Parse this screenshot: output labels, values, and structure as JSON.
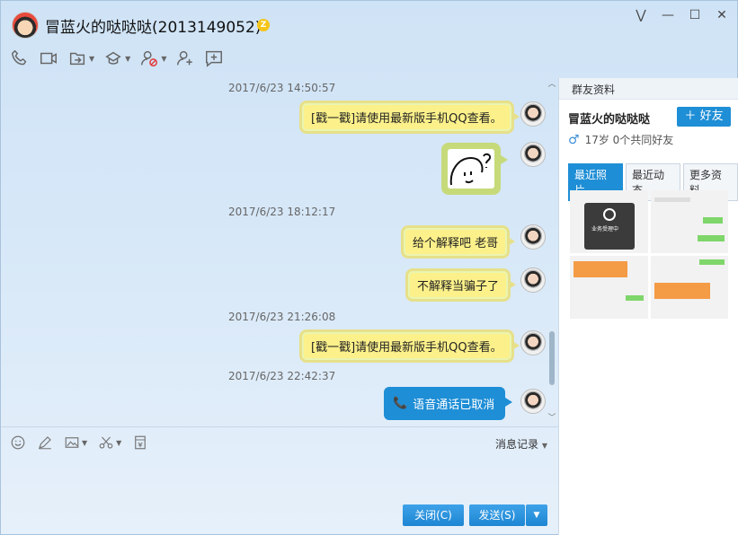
{
  "window": {
    "title": "冒蓝火的哒哒哒(2013149052)",
    "controls": [
      "⋁",
      "—",
      "☐",
      "✕"
    ]
  },
  "toolbar_icons": [
    "phone-icon",
    "video-icon",
    "share-screen-icon",
    "remote-help-icon",
    "block-user-icon",
    "add-contact-icon",
    "new-chat-icon"
  ],
  "messages": [
    {
      "type": "timestamp",
      "text": "2017/6/23 14:50:57"
    },
    {
      "type": "text",
      "text": "[戳一戳]请使用最新版手机QQ查看。"
    },
    {
      "type": "image",
      "alt": "sticker"
    },
    {
      "type": "timestamp",
      "text": "2017/6/23 18:12:17"
    },
    {
      "type": "text",
      "text": "给个解释吧 老哥"
    },
    {
      "type": "text",
      "text": "不解释当骗子了"
    },
    {
      "type": "timestamp",
      "text": "2017/6/23 21:26:08"
    },
    {
      "type": "text",
      "text": "[戳一戳]请使用最新版手机QQ查看。"
    },
    {
      "type": "timestamp",
      "text": "2017/6/23 22:42:37"
    },
    {
      "type": "call",
      "text": "语音通话已取消"
    }
  ],
  "input": {
    "history_label": "消息记录",
    "close_label": "关闭(C)",
    "send_label": "发送(S)"
  },
  "panel": {
    "header": "群友资料",
    "name": "冒蓝火的哒哒哒",
    "add_friend": "好友",
    "meta": "17岁 0个共同好友",
    "tabs": [
      "最近照片",
      "最近动态",
      "更多资料"
    ],
    "photos": {
      "photo1_text": "业务受理中"
    }
  }
}
